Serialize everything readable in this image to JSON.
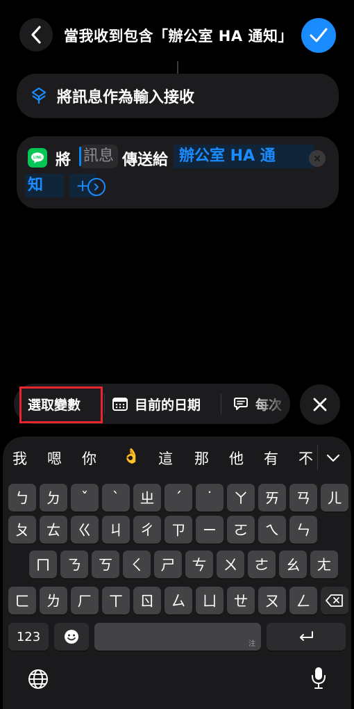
{
  "header": {
    "title": "當我收到包含「辦公室 HA 通知」…"
  },
  "actions": {
    "receive_input": "將訊息作為輸入接收",
    "send_prefix": "將",
    "message_variable": "訊息",
    "send_to": "傳送給",
    "recipient_part1": "辦公室 HA 通",
    "recipient_part2": "知",
    "add_label": "+"
  },
  "variable_bar": {
    "select_variable": "選取變數",
    "current_date": "目前的日期",
    "each_time": "每次"
  },
  "keyboard": {
    "candidates": [
      "我",
      "嗯",
      "你",
      "👌",
      "這",
      "那",
      "他",
      "有",
      "不"
    ],
    "row1": [
      "ㄅ",
      "ㄉ",
      "ˇ",
      "ˋ",
      "ㄓ",
      "ˊ",
      "˙",
      "ㄚ",
      "ㄞ",
      "ㄢ",
      "ㄦ"
    ],
    "row2": [
      "ㄆ",
      "ㄊ",
      "ㄍ",
      "ㄐ",
      "ㄔ",
      "ㄗ",
      "ㄧ",
      "ㄛ",
      "ㄟ",
      "ㄣ"
    ],
    "row3": [
      "ㄇ",
      "ㄋ",
      "ㄎ",
      "ㄑ",
      "ㄕ",
      "ㄘ",
      "ㄨ",
      "ㄜ",
      "ㄠ",
      "ㄤ"
    ],
    "row4": [
      "ㄈ",
      "ㄌ",
      "ㄏ",
      "ㄒ",
      "ㄖ",
      "ㄙ",
      "ㄩ",
      "ㄝ",
      "ㄡ",
      "ㄥ"
    ],
    "numbers_key": "123",
    "space_hint": "注"
  },
  "colors": {
    "accent_blue": "#1a8cff",
    "line_green": "#06c755",
    "highlight_red": "#e8262d"
  }
}
